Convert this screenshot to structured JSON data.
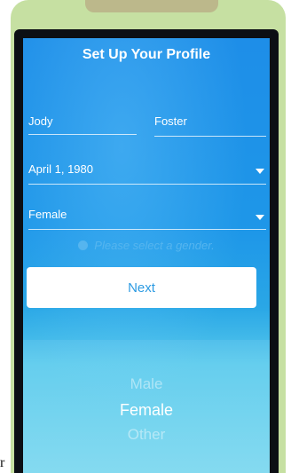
{
  "caption_char": "r",
  "profile": {
    "title": "Set Up Your Profile",
    "first_name": "Jody",
    "last_name": "Foster",
    "birthdate": "April 1, 1980",
    "gender": "Female",
    "error": "Please select a gender.",
    "next_label": "Next"
  },
  "picker": {
    "options": [
      "Male",
      "Female",
      "Other"
    ],
    "selected": "Female"
  },
  "colors": {
    "accent": "#2d9be2",
    "error": "#55b5ef"
  }
}
